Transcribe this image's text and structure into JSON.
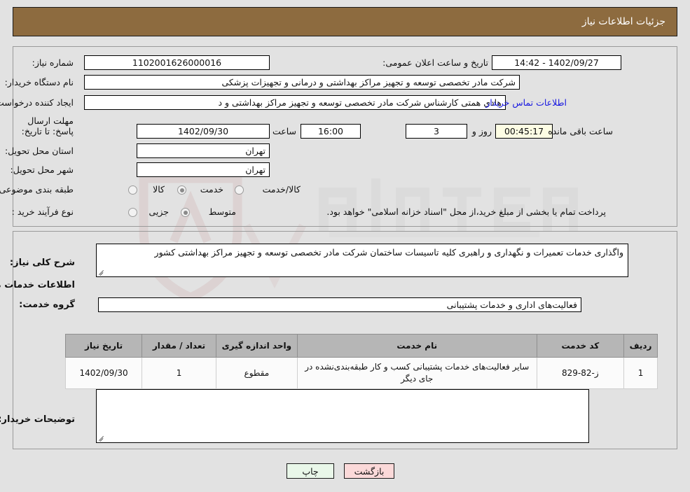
{
  "header": {
    "title": "جزئیات اطلاعات نیاز",
    "bg_color": "#8d6b3f"
  },
  "need_info": {
    "need_number_label": "شماره نیاز:",
    "need_number_value": "1102001626000016",
    "announce_datetime_label": "تاریخ و ساعت اعلان عمومی:",
    "announce_datetime_value": "1402/09/27 - 14:42",
    "buyer_org_label": "نام دستگاه خریدار:",
    "buyer_org_value": "شرکت مادر تخصصی توسعه و تجهیز مراکز بهداشتی و درمانی و تجهیزات پزشکی",
    "requester_label": "ایجاد کننده درخواست:",
    "requester_value": "هادی همتی کارشناس شرکت مادر تخصصی توسعه و تجهیز مراکز بهداشتی و د",
    "buyer_contact_link": "اطلاعات تماس خریدار",
    "deadline_label": "مهلت ارسال پاسخ: تا تاریخ:",
    "deadline_date": "1402/09/30",
    "hour_label": "ساعت",
    "deadline_time": "16:00",
    "days_remaining": "3",
    "days_label": "روز و",
    "countdown": "00:45:17",
    "countdown_suffix": "ساعت باقی مانده",
    "province_label": "استان محل تحویل:",
    "province_value": "تهران",
    "city_label": "شهر محل تحویل:",
    "city_value": "تهران"
  },
  "classification": {
    "label": "طبقه بندی موضوعی:",
    "options": [
      {
        "label": "کالا",
        "selected": false
      },
      {
        "label": "خدمت",
        "selected": true
      },
      {
        "label": "کالا/خدمت",
        "selected": false
      }
    ]
  },
  "purchase_type": {
    "label": "نوع فرآیند خرید :",
    "options": [
      {
        "label": "جزیی",
        "selected": false
      },
      {
        "label": "متوسط",
        "selected": true
      }
    ],
    "note": "پرداخت تمام یا بخشی از مبلغ خرید،از محل \"اسناد خزانه اسلامی\" خواهد بود."
  },
  "description": {
    "label": "شرح کلی نیاز:",
    "value": "واگذاری خدمات تعمیرات و نگهداری و راهبری کلیه تاسیسات ساختمان شرکت مادر تخصصی توسعه و تجهیز مراکز بهداشتی کشور"
  },
  "services_section": {
    "heading": "اطلاعات خدمات مورد نیاز",
    "group_label": "گروه خدمت:",
    "group_value": "فعالیت‌های اداری و خدمات پشتیبانی"
  },
  "table": {
    "columns": [
      "ردیف",
      "کد خدمت",
      "نام خدمت",
      "واحد اندازه گیری",
      "تعداد / مقدار",
      "تاریخ نیاز"
    ],
    "rows": [
      {
        "row": "1",
        "code": "ز-82-829",
        "name": "سایر فعالیت‌های خدمات پشتیبانی کسب و کار طبقه‌بندی‌نشده در جای دیگر",
        "unit": "مقطوع",
        "qty": "1",
        "date": "1402/09/30"
      }
    ]
  },
  "buyer_notes": {
    "label": "توضیحات خریدار:",
    "value": "",
    "placeholder": ""
  },
  "buttons": {
    "print": "چاپ",
    "back": "بازگشت"
  },
  "watermark": {
    "text": "AriaTender.net"
  }
}
